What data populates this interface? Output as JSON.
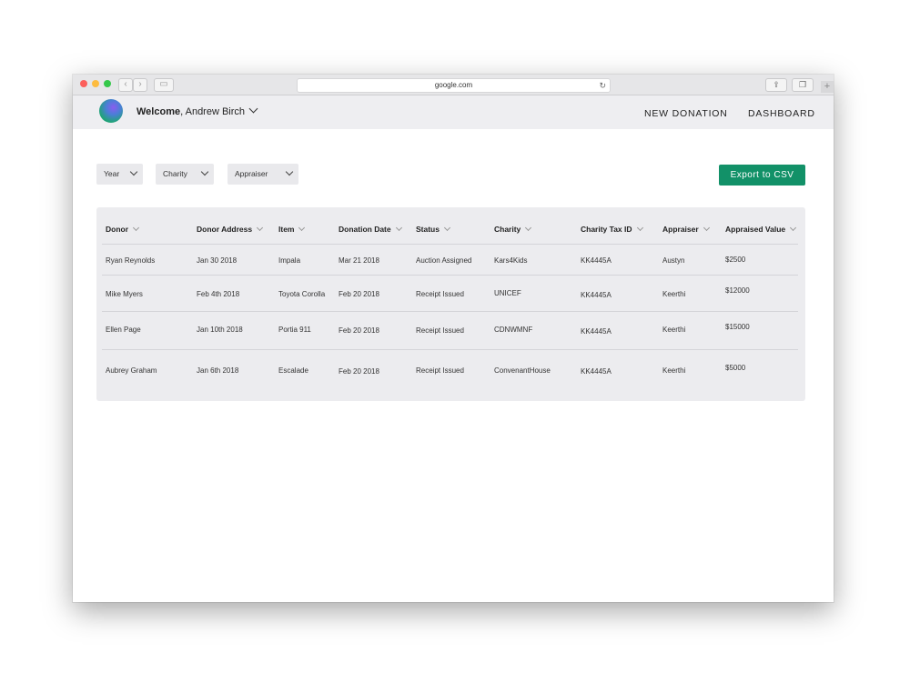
{
  "browser": {
    "url": "google.com"
  },
  "header": {
    "welcome_label": "Welcome",
    "user_name": "Andrew Birch",
    "nav": [
      "NEW DONATION",
      "DASHBOARD"
    ]
  },
  "filters": [
    "Year",
    "Charity",
    "Appraiser"
  ],
  "export_label": "Export to CSV",
  "table": {
    "columns": [
      "Donor",
      "Donor Address",
      "Item",
      "Donation Date",
      "Status",
      "Charity",
      "Charity Tax ID",
      "Appraiser",
      "Appraised Value"
    ],
    "rows": [
      [
        "Ryan Reynolds",
        "Jan 30 2018",
        "Impala",
        "Mar 21 2018",
        "Auction Assigned",
        "Kars4Kids",
        "KK4445A",
        "Austyn",
        "$2500"
      ],
      [
        "Mike Myers",
        "Feb 4th 2018",
        "Toyota Corolla",
        "Feb 20 2018",
        "Receipt Issued",
        "UNICEF",
        "KK4445A",
        "Keerthi",
        "$12000"
      ],
      [
        "Ellen Page",
        "Jan 10th 2018",
        "Portia 911",
        "Feb 20 2018",
        "Receipt Issued",
        "CDNWMNF",
        "KK4445A",
        "Keerthi",
        "$15000"
      ],
      [
        "Aubrey Graham",
        "Jan 6th 2018",
        "Escalade",
        "Feb 20 2018",
        "Receipt Issued",
        "ConvenantHouse",
        "KK4445A",
        "Keerthi",
        "$5000"
      ]
    ]
  },
  "colors": {
    "accent": "#129168",
    "header_bg": "#eeeef1",
    "table_bg": "#ececef"
  }
}
